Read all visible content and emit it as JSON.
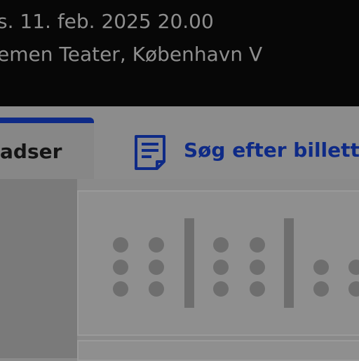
{
  "event": {
    "date_time": "s. 11. feb. 2025 20.00",
    "venue": "emen Teater, København V"
  },
  "tabs": {
    "seats_label": "adser",
    "search_label": "Søg efter billette"
  },
  "icons": {
    "search_tab_icon": "document-list-icon"
  },
  "colors": {
    "accent": "#0e2a86",
    "header_bg": "#070707",
    "seat": "#6e6e6e"
  }
}
